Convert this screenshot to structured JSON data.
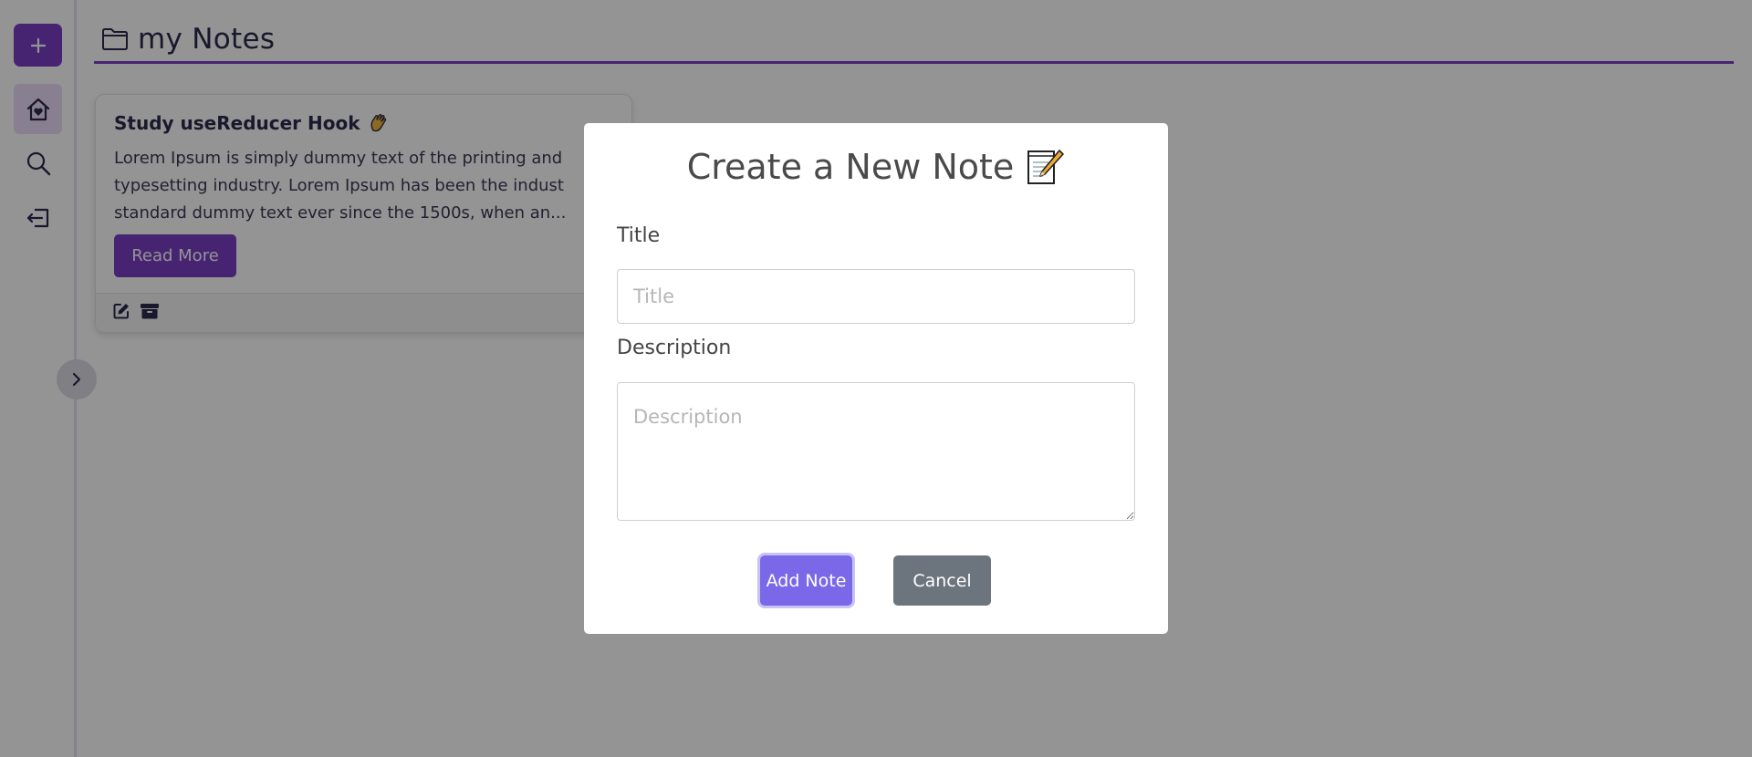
{
  "sidebar": {
    "items": [
      {
        "name": "add",
        "icon": "plus-icon"
      },
      {
        "name": "home",
        "icon": "home-heart-icon"
      },
      {
        "name": "search",
        "icon": "search-icon"
      },
      {
        "name": "logout",
        "icon": "logout-icon"
      }
    ],
    "collapse_icon": "chevron-right-icon"
  },
  "header": {
    "icon": "folder-icon",
    "title": "my Notes"
  },
  "note": {
    "title": "Study useReducer Hook",
    "title_emoji": "waving-hand-icon",
    "description_lines": [
      "Lorem Ipsum is simply dummy text of the printing and",
      "typesetting industry. Lorem Ipsum has been the indust",
      "standard dummy text ever since the 1500s, when an..."
    ],
    "read_more_label": "Read More",
    "footer_icons": [
      "edit-icon",
      "archive-icon"
    ]
  },
  "modal": {
    "title": "Create a New Note",
    "title_emoji": "memo-icon",
    "title_label": "Title",
    "title_placeholder": "Title",
    "title_value": "",
    "description_label": "Description",
    "description_placeholder": "Description",
    "description_value": "",
    "add_button_label": "Add Note",
    "cancel_button_label": "Cancel"
  },
  "colors": {
    "brand_purple": "#7b3fc4",
    "add_note_button": "#7b68e8",
    "cancel_button": "#6c757d",
    "overlay": "rgba(0,0,0,0.42)"
  }
}
